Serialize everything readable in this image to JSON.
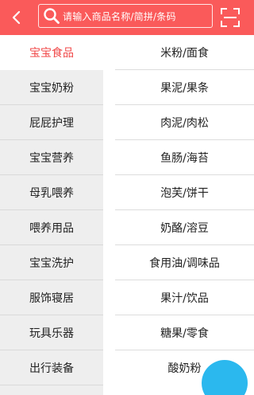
{
  "header": {
    "search_placeholder": "请输入商品名称/简拼/条码",
    "bg_color": "#fa5a5a"
  },
  "icons": {
    "back": "back-arrow-icon",
    "search": "search-icon",
    "scan": "scan-icon"
  },
  "categories": [
    {
      "label": "宝宝食品",
      "active": true
    },
    {
      "label": "宝宝奶粉",
      "active": false
    },
    {
      "label": "屁屁护理",
      "active": false
    },
    {
      "label": "宝宝营养",
      "active": false
    },
    {
      "label": "母乳喂养",
      "active": false
    },
    {
      "label": "喂养用品",
      "active": false
    },
    {
      "label": "宝宝洗护",
      "active": false
    },
    {
      "label": "服饰寝居",
      "active": false
    },
    {
      "label": "玩具乐器",
      "active": false
    },
    {
      "label": "出行装备",
      "active": false
    }
  ],
  "subcategories": [
    {
      "label": "米粉/面食"
    },
    {
      "label": "果泥/果条"
    },
    {
      "label": "肉泥/肉松"
    },
    {
      "label": "鱼肠/海苔"
    },
    {
      "label": "泡芙/饼干"
    },
    {
      "label": "奶酪/溶豆"
    },
    {
      "label": "食用油/调味品"
    },
    {
      "label": "果汁/饮品"
    },
    {
      "label": "糖果/零食"
    },
    {
      "label": "酸奶粉"
    }
  ],
  "colors": {
    "accent": "#f04848",
    "sidebar_bg": "#eeeeee",
    "float_button": "#2bb8ee"
  }
}
